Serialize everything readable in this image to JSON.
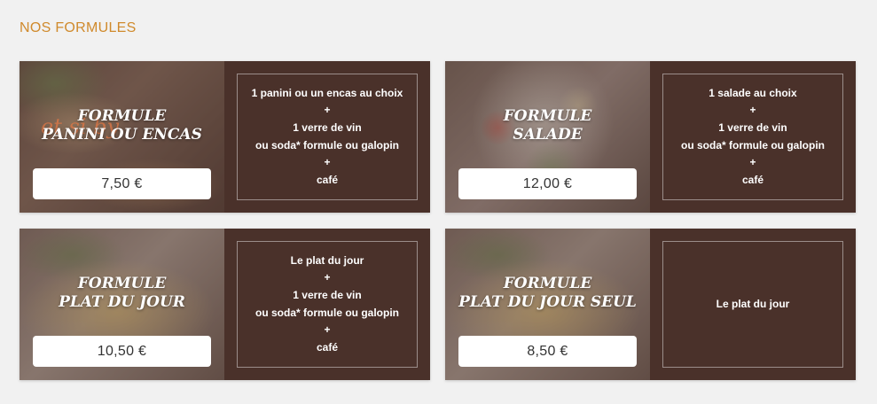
{
  "section": {
    "title": "NOS FORMULES"
  },
  "cards": [
    {
      "name_line1": "FORMULE",
      "name_line2": "PANINI OU ENCAS",
      "watermark": "et si by",
      "price": "7,50 €",
      "details": [
        "1 panini ou un encas au choix",
        "+",
        "1 verre de vin",
        "ou soda* formule ou galopin",
        "+",
        "café"
      ]
    },
    {
      "name_line1": "FORMULE",
      "name_line2": "SALADE",
      "price": "12,00 €",
      "details": [
        "1 salade au choix",
        "+",
        "1 verre de vin",
        "ou soda* formule ou galopin",
        "+",
        "café"
      ]
    },
    {
      "name_line1": "FORMULE",
      "name_line2": "PLAT DU JOUR",
      "price": "10,50 €",
      "details": [
        "Le plat du jour",
        "+",
        "1 verre de vin",
        "ou soda* formule ou galopin",
        "+",
        "café"
      ]
    },
    {
      "name_line1": "FORMULE",
      "name_line2": "PLAT DU JOUR SEUL",
      "price": "8,50 €",
      "details": [
        "Le plat du jour"
      ]
    }
  ]
}
